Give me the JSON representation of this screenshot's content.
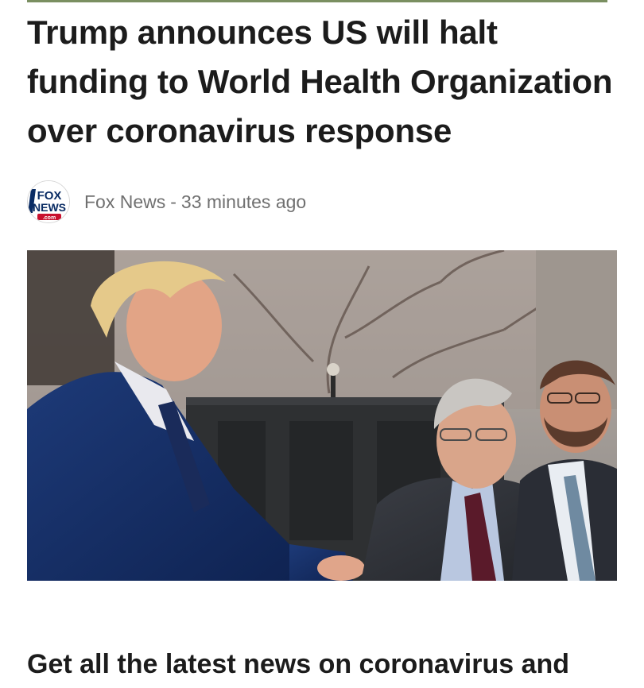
{
  "article": {
    "headline": "Trump announces US will halt funding to World Health Organization over coronavirus response",
    "source": {
      "name": "Fox News",
      "separator": "-",
      "time": "33 minutes ago",
      "logo_icon": "fox-news-logo-icon",
      "logo_text_top": "FOX",
      "logo_text_bottom": "NEWS",
      "logo_text_domain": ".com"
    },
    "image": {
      "semantic": "news-photo-people-outdoors"
    },
    "teaser": "Get all the latest news on coronavirus and"
  },
  "colors": {
    "accent_rule": "#7a8f61",
    "headline": "#1c1c1c",
    "meta_text": "#707070",
    "fox_blue": "#0a2c64",
    "fox_red": "#c8102e"
  }
}
